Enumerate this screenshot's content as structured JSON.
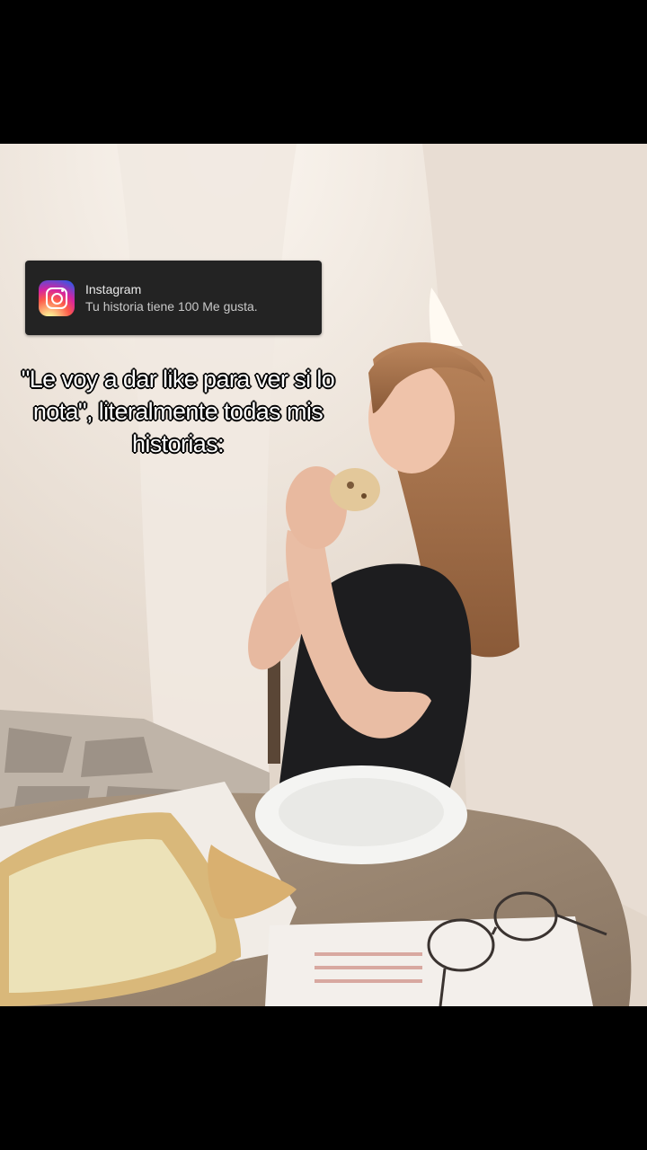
{
  "notification": {
    "app_name": "Instagram",
    "message": "Tu historia tiene 100 Me gusta.",
    "icon": "instagram-icon"
  },
  "caption": {
    "text": "\"Le voy a dar like para ver si lo nota\", literalmente todas mis historias:"
  }
}
